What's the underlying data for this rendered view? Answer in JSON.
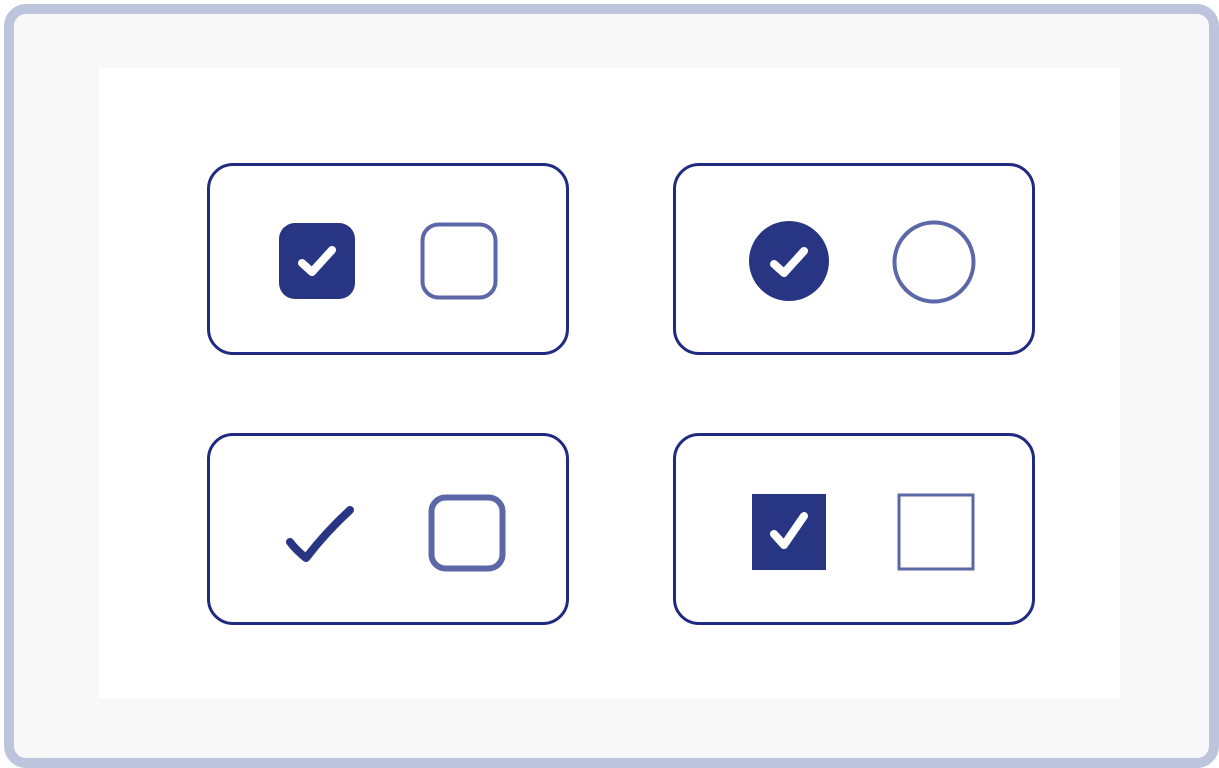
{
  "colors": {
    "accent": "#283583",
    "outline": "#1f2a80",
    "unchecked_outline": "#5c67a8",
    "frame": "#bcc5dc",
    "background": "#f8f8f8"
  },
  "controls": [
    {
      "style": "rounded-checkbox",
      "checked": {
        "icon": "check-icon",
        "state": "checked"
      },
      "unchecked": {
        "icon": "empty-rounded-square-icon",
        "state": "unchecked"
      }
    },
    {
      "style": "radio",
      "checked": {
        "icon": "check-icon",
        "state": "checked"
      },
      "unchecked": {
        "icon": "empty-circle-icon",
        "state": "unchecked"
      }
    },
    {
      "style": "plain-check",
      "checked": {
        "icon": "check-icon",
        "state": "checked"
      },
      "unchecked": {
        "icon": "empty-rounded-square-icon",
        "state": "unchecked"
      }
    },
    {
      "style": "square-checkbox",
      "checked": {
        "icon": "check-icon",
        "state": "checked"
      },
      "unchecked": {
        "icon": "empty-square-icon",
        "state": "unchecked"
      }
    }
  ]
}
